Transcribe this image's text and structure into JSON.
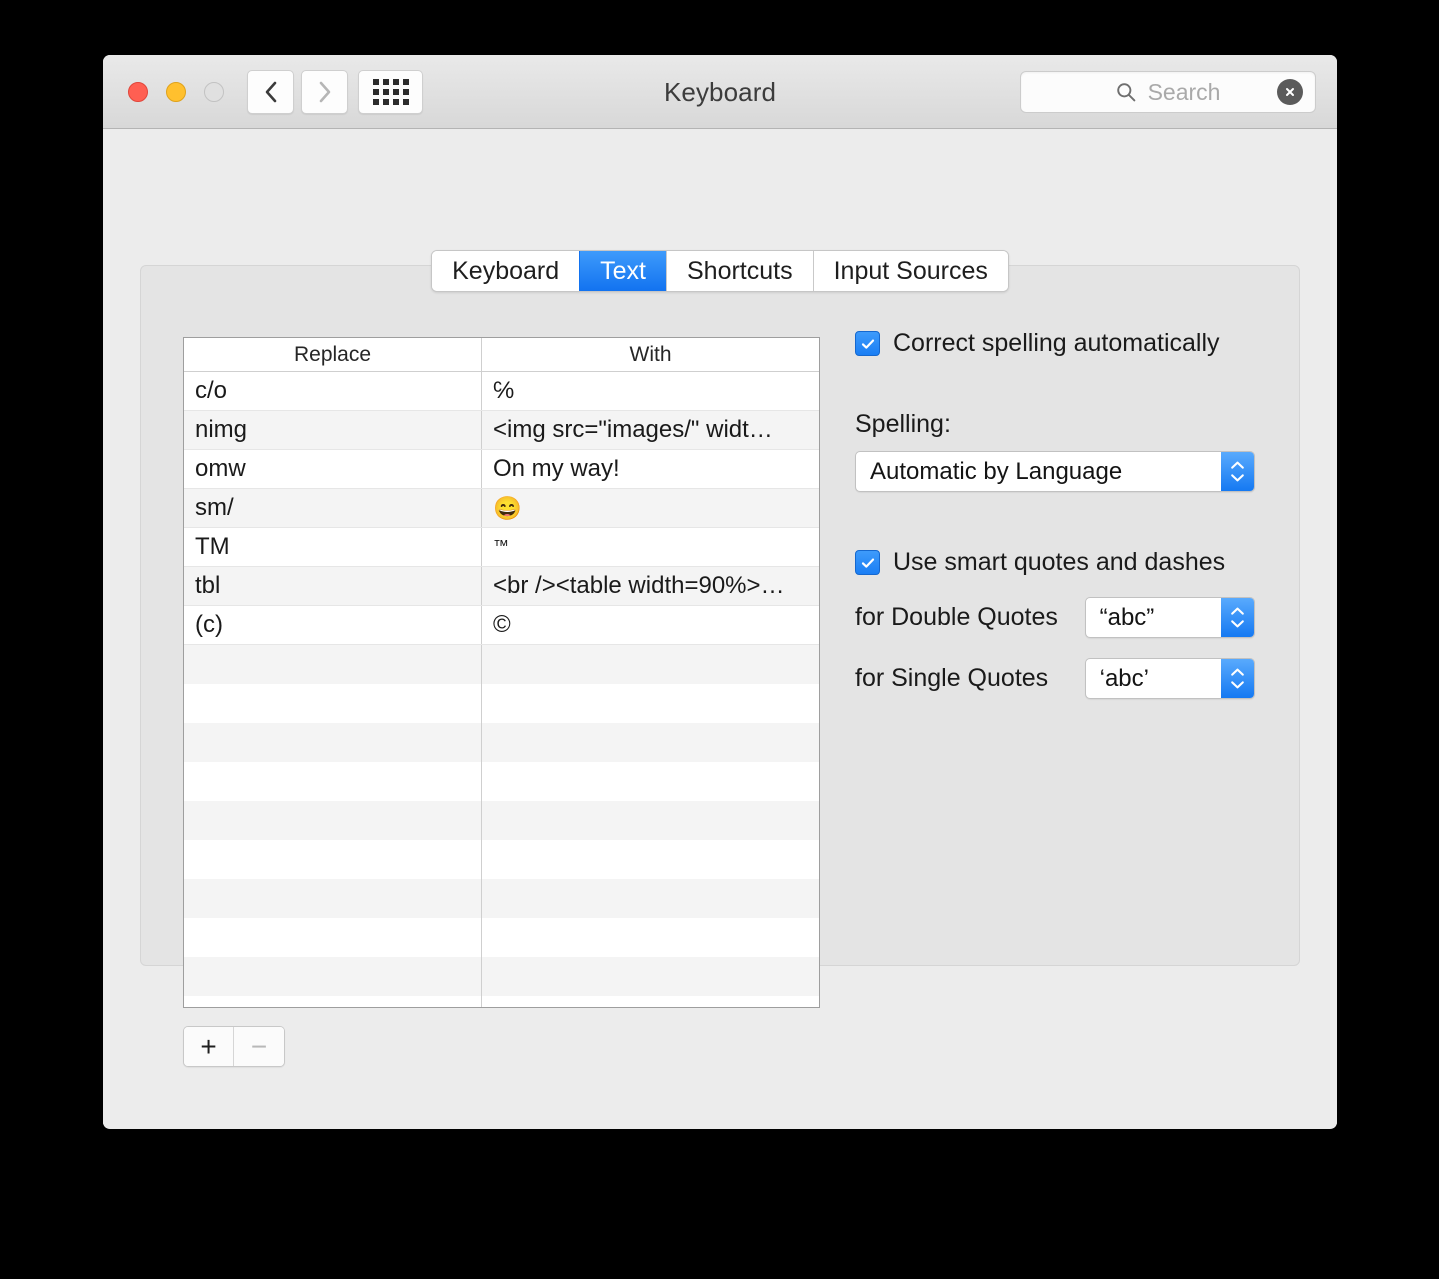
{
  "window": {
    "title": "Keyboard",
    "traffic_lights": [
      "close",
      "minimize",
      "zoom"
    ]
  },
  "toolbar": {
    "back_icon": "chevron-left-icon",
    "forward_icon": "chevron-right-icon",
    "show_all_icon": "grid-icon"
  },
  "search": {
    "placeholder": "Search",
    "value": "",
    "icon": "search-icon",
    "clear_icon": "clear-icon"
  },
  "tabs": [
    {
      "label": "Keyboard",
      "selected": false
    },
    {
      "label": "Text",
      "selected": true
    },
    {
      "label": "Shortcuts",
      "selected": false
    },
    {
      "label": "Input Sources",
      "selected": false
    }
  ],
  "table": {
    "columns": [
      "Replace",
      "With"
    ],
    "rows": [
      {
        "replace": "c/o",
        "with": "℅"
      },
      {
        "replace": "nimg",
        "with": "<img src=\"images/\" widt…"
      },
      {
        "replace": "omw",
        "with": "On my way!"
      },
      {
        "replace": "sm/",
        "with": "😄"
      },
      {
        "replace": "TM",
        "with": "™"
      },
      {
        "replace": "tbl",
        "with": "<br /><table width=90%>…"
      },
      {
        "replace": "(c)",
        "with": "©"
      }
    ],
    "empty_row_count": 13
  },
  "buttons": {
    "add_label": "+",
    "remove_label": "−",
    "remove_enabled": false
  },
  "options": {
    "correct_spelling": {
      "label": "Correct spelling automatically",
      "checked": true
    },
    "spelling_label": "Spelling:",
    "spelling_value": "Automatic by Language",
    "smart_quotes": {
      "label": "Use smart quotes and dashes",
      "checked": true
    },
    "double_quotes_label": "for Double Quotes",
    "double_quotes_value": "“abc”",
    "single_quotes_label": "for Single Quotes",
    "single_quotes_value": "‘abc’"
  },
  "help": {
    "label": "?"
  },
  "colors": {
    "accent_blue": "#1a7ef4",
    "tab_selected": "#1273f0",
    "window_bg": "#ececec",
    "panel_bg": "#e4e4e4",
    "row_alt": "#f4f4f4",
    "help_blue": "#1f77f0"
  }
}
